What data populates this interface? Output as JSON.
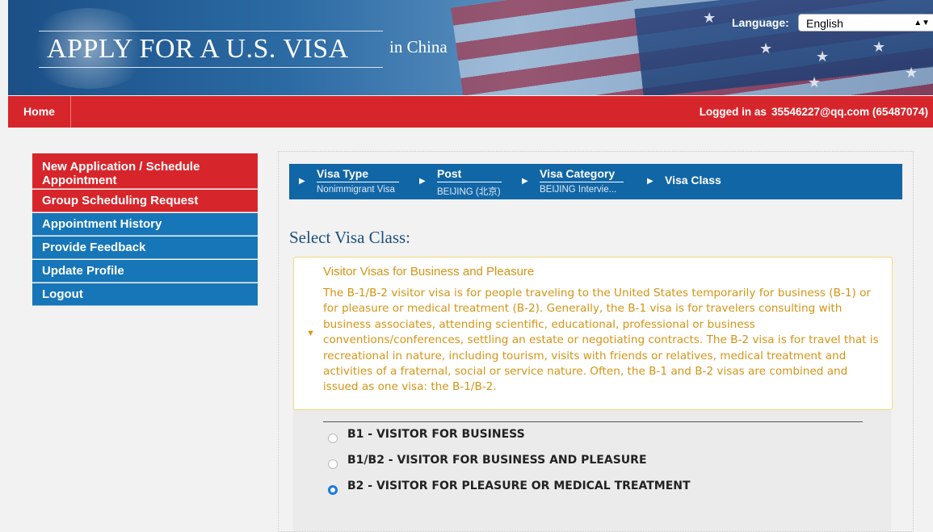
{
  "header": {
    "title": "APPLY FOR A U.S. VISA",
    "subtitle": "in China",
    "language_label": "Language:",
    "language_value": "English"
  },
  "navbar": {
    "home": "Home",
    "logged_in_label": "Logged in as",
    "user": "35546227@qq.com (65487074)"
  },
  "sidebar": {
    "items": [
      {
        "label": "New Application / Schedule Appointment",
        "color": "#d7262b"
      },
      {
        "label": "Group Scheduling Request",
        "color": "#d7262b"
      },
      {
        "label": "Appointment History",
        "color": "#1676b8"
      },
      {
        "label": "Provide Feedback",
        "color": "#1676b8"
      },
      {
        "label": "Update Profile",
        "color": "#1676b8"
      },
      {
        "label": "Logout",
        "color": "#1676b8"
      }
    ]
  },
  "breadcrumb": [
    {
      "label": "Visa Type",
      "value": "Nonimmigrant Visa"
    },
    {
      "label": "Post",
      "value": "BEIJING (北京)"
    },
    {
      "label": "Visa Category",
      "value": "BEIJING Intervie..."
    },
    {
      "label": "Visa Class",
      "value": ""
    }
  ],
  "main": {
    "section_title": "Select Visa Class:",
    "info": {
      "title": "Visitor Visas for Business and Pleasure",
      "text": "The B-1/B-2 visitor visa is for people traveling to the United States temporarily for business (B-1) or for pleasure or medical treatment (B-2). Generally, the B-1 visa is for travelers consulting with business associates, attending scientific, educational, professional or business conventions/conferences, settling an estate or negotiating contracts. The B-2 visa is for travel that is recreational in nature, including tourism, visits with friends or relatives, medical treatment and activities of a fraternal, social or service nature. Often, the B-1 and B-2 visas are combined and issued as one visa: the B-1/B-2."
    },
    "options": [
      {
        "label": "B1 - VISITOR FOR BUSINESS",
        "selected": false
      },
      {
        "label": "B1/B2 - VISITOR FOR BUSINESS AND PLEASURE",
        "selected": false
      },
      {
        "label": "B2 - VISITOR FOR PLEASURE OR MEDICAL TREATMENT",
        "selected": true
      }
    ]
  },
  "colors": {
    "brand_red": "#d7262b",
    "brand_blue": "#1676b8",
    "breadcrumb_blue": "#1166a6",
    "info_text": "#d49416",
    "radio_selected": "#1a7ae0"
  }
}
